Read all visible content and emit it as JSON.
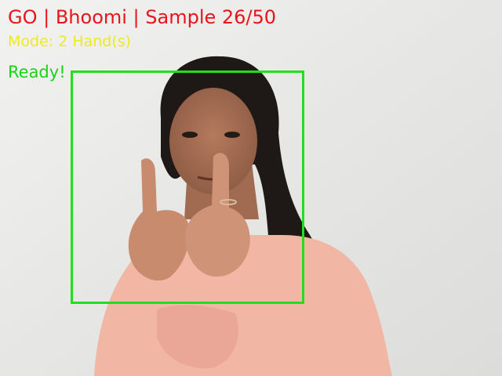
{
  "overlay": {
    "title": "GO | Bhoomi | Sample 26/50",
    "mode": "Mode: 2 Hand(s)",
    "status": "Ready!"
  },
  "colors": {
    "title": "#e8141b",
    "mode": "#eeea22",
    "status": "#17d417",
    "roi_box": "#22dd22",
    "background": "#ecebea",
    "shirt": "#f1b4a3",
    "skin": "#c98b6d",
    "hair": "#1c1715"
  },
  "camera": {
    "sample_current": 26,
    "sample_total": 50
  }
}
